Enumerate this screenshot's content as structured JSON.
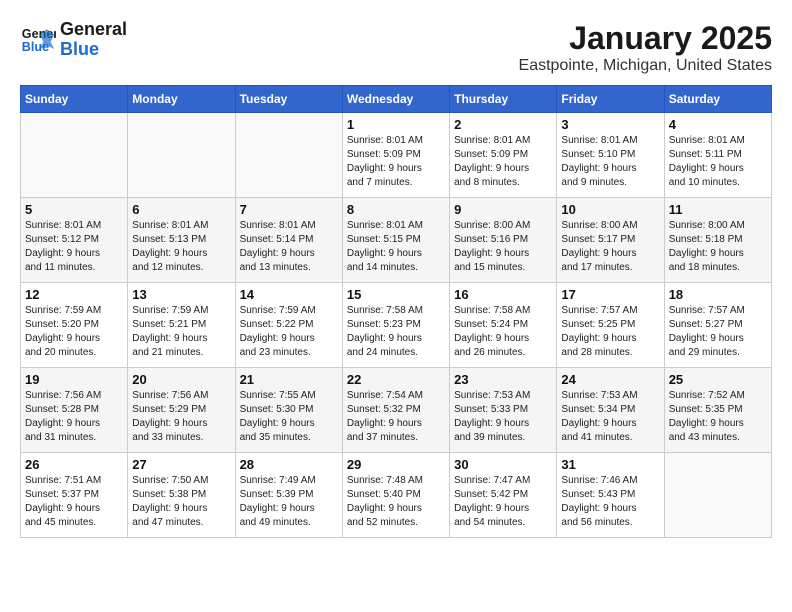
{
  "header": {
    "logo_line1": "General",
    "logo_line2": "Blue",
    "title": "January 2025",
    "subtitle": "Eastpointe, Michigan, United States"
  },
  "days_of_week": [
    "Sunday",
    "Monday",
    "Tuesday",
    "Wednesday",
    "Thursday",
    "Friday",
    "Saturday"
  ],
  "weeks": [
    [
      {
        "day": "",
        "info": ""
      },
      {
        "day": "",
        "info": ""
      },
      {
        "day": "",
        "info": ""
      },
      {
        "day": "1",
        "info": "Sunrise: 8:01 AM\nSunset: 5:09 PM\nDaylight: 9 hours\nand 7 minutes."
      },
      {
        "day": "2",
        "info": "Sunrise: 8:01 AM\nSunset: 5:09 PM\nDaylight: 9 hours\nand 8 minutes."
      },
      {
        "day": "3",
        "info": "Sunrise: 8:01 AM\nSunset: 5:10 PM\nDaylight: 9 hours\nand 9 minutes."
      },
      {
        "day": "4",
        "info": "Sunrise: 8:01 AM\nSunset: 5:11 PM\nDaylight: 9 hours\nand 10 minutes."
      }
    ],
    [
      {
        "day": "5",
        "info": "Sunrise: 8:01 AM\nSunset: 5:12 PM\nDaylight: 9 hours\nand 11 minutes."
      },
      {
        "day": "6",
        "info": "Sunrise: 8:01 AM\nSunset: 5:13 PM\nDaylight: 9 hours\nand 12 minutes."
      },
      {
        "day": "7",
        "info": "Sunrise: 8:01 AM\nSunset: 5:14 PM\nDaylight: 9 hours\nand 13 minutes."
      },
      {
        "day": "8",
        "info": "Sunrise: 8:01 AM\nSunset: 5:15 PM\nDaylight: 9 hours\nand 14 minutes."
      },
      {
        "day": "9",
        "info": "Sunrise: 8:00 AM\nSunset: 5:16 PM\nDaylight: 9 hours\nand 15 minutes."
      },
      {
        "day": "10",
        "info": "Sunrise: 8:00 AM\nSunset: 5:17 PM\nDaylight: 9 hours\nand 17 minutes."
      },
      {
        "day": "11",
        "info": "Sunrise: 8:00 AM\nSunset: 5:18 PM\nDaylight: 9 hours\nand 18 minutes."
      }
    ],
    [
      {
        "day": "12",
        "info": "Sunrise: 7:59 AM\nSunset: 5:20 PM\nDaylight: 9 hours\nand 20 minutes."
      },
      {
        "day": "13",
        "info": "Sunrise: 7:59 AM\nSunset: 5:21 PM\nDaylight: 9 hours\nand 21 minutes."
      },
      {
        "day": "14",
        "info": "Sunrise: 7:59 AM\nSunset: 5:22 PM\nDaylight: 9 hours\nand 23 minutes."
      },
      {
        "day": "15",
        "info": "Sunrise: 7:58 AM\nSunset: 5:23 PM\nDaylight: 9 hours\nand 24 minutes."
      },
      {
        "day": "16",
        "info": "Sunrise: 7:58 AM\nSunset: 5:24 PM\nDaylight: 9 hours\nand 26 minutes."
      },
      {
        "day": "17",
        "info": "Sunrise: 7:57 AM\nSunset: 5:25 PM\nDaylight: 9 hours\nand 28 minutes."
      },
      {
        "day": "18",
        "info": "Sunrise: 7:57 AM\nSunset: 5:27 PM\nDaylight: 9 hours\nand 29 minutes."
      }
    ],
    [
      {
        "day": "19",
        "info": "Sunrise: 7:56 AM\nSunset: 5:28 PM\nDaylight: 9 hours\nand 31 minutes."
      },
      {
        "day": "20",
        "info": "Sunrise: 7:56 AM\nSunset: 5:29 PM\nDaylight: 9 hours\nand 33 minutes."
      },
      {
        "day": "21",
        "info": "Sunrise: 7:55 AM\nSunset: 5:30 PM\nDaylight: 9 hours\nand 35 minutes."
      },
      {
        "day": "22",
        "info": "Sunrise: 7:54 AM\nSunset: 5:32 PM\nDaylight: 9 hours\nand 37 minutes."
      },
      {
        "day": "23",
        "info": "Sunrise: 7:53 AM\nSunset: 5:33 PM\nDaylight: 9 hours\nand 39 minutes."
      },
      {
        "day": "24",
        "info": "Sunrise: 7:53 AM\nSunset: 5:34 PM\nDaylight: 9 hours\nand 41 minutes."
      },
      {
        "day": "25",
        "info": "Sunrise: 7:52 AM\nSunset: 5:35 PM\nDaylight: 9 hours\nand 43 minutes."
      }
    ],
    [
      {
        "day": "26",
        "info": "Sunrise: 7:51 AM\nSunset: 5:37 PM\nDaylight: 9 hours\nand 45 minutes."
      },
      {
        "day": "27",
        "info": "Sunrise: 7:50 AM\nSunset: 5:38 PM\nDaylight: 9 hours\nand 47 minutes."
      },
      {
        "day": "28",
        "info": "Sunrise: 7:49 AM\nSunset: 5:39 PM\nDaylight: 9 hours\nand 49 minutes."
      },
      {
        "day": "29",
        "info": "Sunrise: 7:48 AM\nSunset: 5:40 PM\nDaylight: 9 hours\nand 52 minutes."
      },
      {
        "day": "30",
        "info": "Sunrise: 7:47 AM\nSunset: 5:42 PM\nDaylight: 9 hours\nand 54 minutes."
      },
      {
        "day": "31",
        "info": "Sunrise: 7:46 AM\nSunset: 5:43 PM\nDaylight: 9 hours\nand 56 minutes."
      },
      {
        "day": "",
        "info": ""
      }
    ]
  ]
}
